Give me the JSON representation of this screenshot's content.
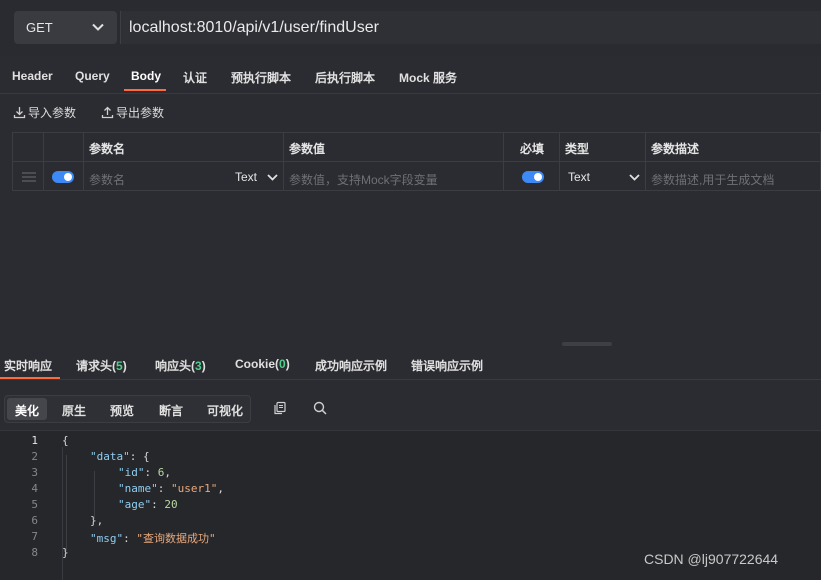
{
  "request": {
    "method": "GET",
    "url": "localhost:8010/api/v1/user/findUser"
  },
  "tabs": [
    "Header",
    "Query",
    "Body",
    "认证",
    "预执行脚本",
    "后执行脚本",
    "Mock 服务"
  ],
  "active_tab": "Body",
  "actions": {
    "import_label": "导入参数",
    "export_label": "导出参数"
  },
  "params_table": {
    "headers": {
      "name": "参数名",
      "value": "参数值",
      "required": "必填",
      "type": "类型",
      "desc": "参数描述"
    },
    "row": {
      "enabled": true,
      "name_placeholder": "参数名",
      "name_type": "Text",
      "value_placeholder": "参数值，支持Mock字段变量",
      "required": true,
      "type": "Text",
      "desc_placeholder": "参数描述,用于生成文档"
    }
  },
  "response_tabs": {
    "realtime": "实时响应",
    "req_headers": "请求头",
    "req_headers_count": "5",
    "resp_headers": "响应头",
    "resp_headers_count": "3",
    "cookie": "Cookie",
    "cookie_count": "0",
    "success_example": "成功响应示例",
    "error_example": "错误响应示例"
  },
  "view_modes": [
    "美化",
    "原生",
    "预览",
    "断言",
    "可视化"
  ],
  "active_view": "美化",
  "icons": [
    "copy-icon",
    "search-icon",
    "import-icon",
    "export-icon",
    "chevron-down-icon",
    "drag-handle-icon"
  ],
  "code": {
    "line_numbers": [
      "1",
      "2",
      "3",
      "4",
      "5",
      "6",
      "7",
      "8"
    ],
    "open_brace": "{",
    "data_key": "\"data\"",
    "id_key": "\"id\"",
    "id_value": "6",
    "name_key": "\"name\"",
    "name_value": "\"user1\"",
    "age_key": "\"age\"",
    "age_value": "20",
    "msg_key": "\"msg\"",
    "msg_value": "\"查询数据成功\"",
    "close_inner": "},",
    "close_brace": "}"
  },
  "watermark": "CSDN @lj907722644",
  "colors": {
    "accent": "#ff6a3d",
    "toggle": "#3d8af7",
    "count": "#4fd08a",
    "json_key": "#8fcdf0",
    "json_string": "#e9a87c",
    "json_number": "#b8d7a3"
  }
}
